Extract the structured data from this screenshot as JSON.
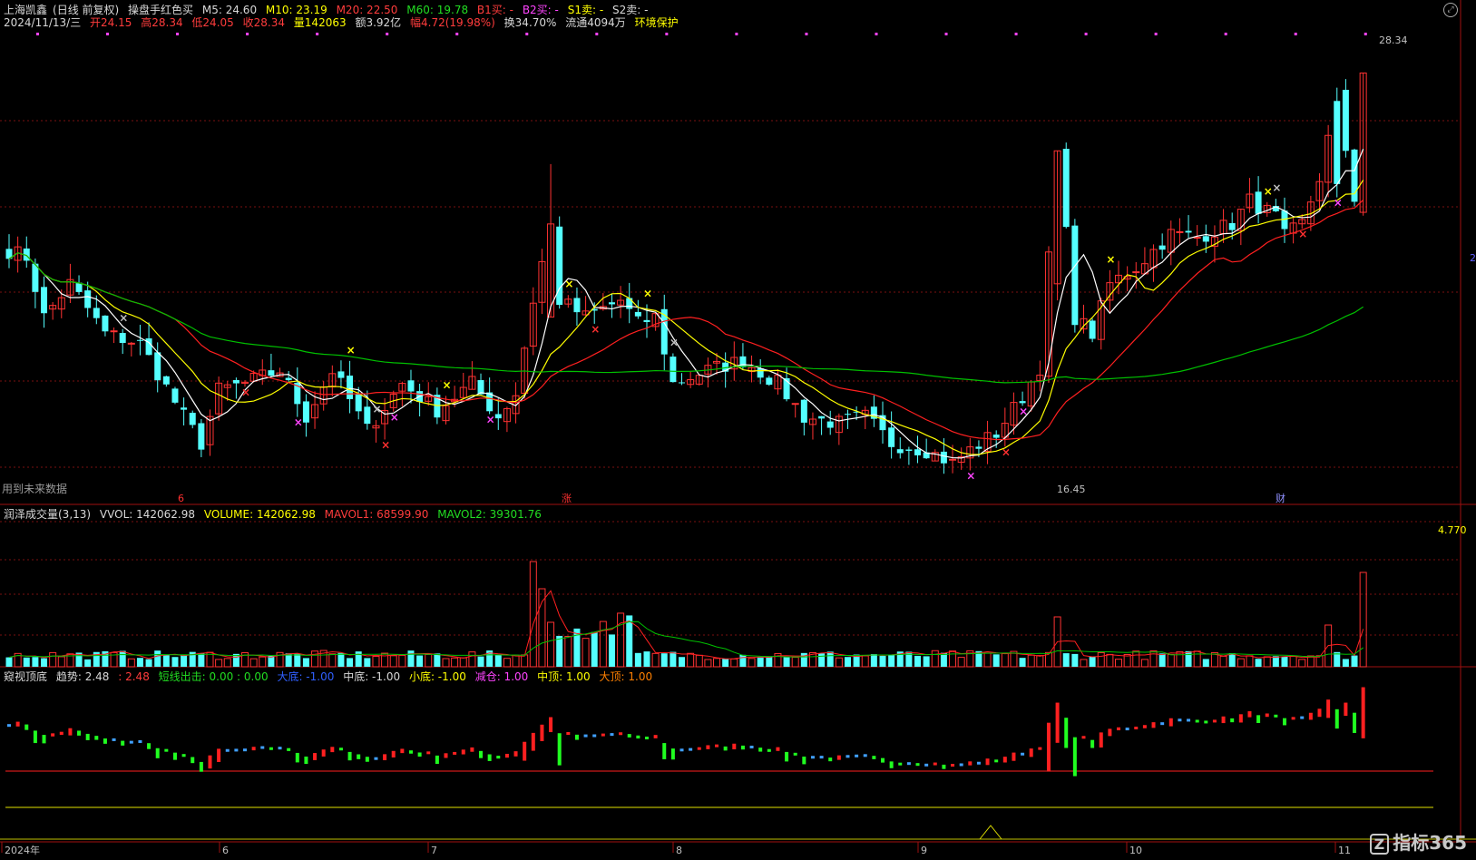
{
  "header": {
    "stock_name": "上海凯鑫",
    "mode": "(日线 前复权)",
    "indicator": "操盘手红色买",
    "m5": "M5: 24.60",
    "m10": "M10: 23.19",
    "m20": "M20: 22.50",
    "m60": "M60: 19.78",
    "b1": "B1买: -",
    "b2": "B2买: -",
    "s1": "S1卖: -",
    "s2": "S2卖: -",
    "date": "2024/11/13/三",
    "open": "开24.15",
    "high": "高28.34",
    "low": "低24.05",
    "close": "收28.34",
    "volume": "量142063",
    "amount": "额3.92亿",
    "change": "幅4.72(19.98%)",
    "turnover": "换34.70%",
    "float": "流通4094万",
    "tag": "环境保护"
  },
  "price_panel": {
    "high_label": "28.34",
    "low_label": "16.45",
    "future_note": "用到未来数据",
    "event_6": "6",
    "event_zhang": "涨",
    "event_cai": "财",
    "right_mark": "2"
  },
  "volume_panel": {
    "title": "润泽成交量(3,13)",
    "vvol": "VVOL: 142062.98",
    "volume": "VOLUME: 142062.98",
    "mavol1": "MAVOL1: 68599.90",
    "mavol2": "MAVOL2: 39301.76",
    "max_label": "4.770"
  },
  "trend_panel": {
    "title": "窥视顶底",
    "trend": "趋势: 2.48",
    "trend2": ": 2.48",
    "short": "短线出击: 0.00 : 0.00",
    "big_bottom": "大底: -1.00",
    "mid_bottom": "中底: -1.00",
    "small_bottom": "小底: -1.00",
    "reduce": "减仓: 1.00",
    "mid_top": "中顶: 1.00",
    "big_top": "大顶: 1.00"
  },
  "x_axis": {
    "labels": [
      "2024年",
      "6",
      "7",
      "8",
      "9",
      "10",
      "11"
    ]
  },
  "logo": {
    "icon": "Z",
    "text": "指标365"
  },
  "colors": {
    "up": "#ff3232",
    "down": "#54ffff",
    "m5": "#ffffff",
    "m10": "#ffff00",
    "m20": "#ff2020",
    "m60": "#00c000"
  },
  "chart_data": {
    "type": "candlestick",
    "n": 125,
    "key_prices": {
      "high": 28.34,
      "low": 16.45
    },
    "key_points": [
      [
        0,
        23.0
      ],
      [
        2,
        22.8
      ],
      [
        4,
        21.0
      ],
      [
        7,
        22.0
      ],
      [
        11,
        20.5
      ],
      [
        15,
        20.2
      ],
      [
        20,
        18.0
      ],
      [
        22,
        17.2
      ],
      [
        24,
        18.8
      ],
      [
        27,
        19.0
      ],
      [
        31,
        19.4
      ],
      [
        34,
        18.0
      ],
      [
        37,
        19.4
      ],
      [
        41,
        17.6
      ],
      [
        45,
        19.0
      ],
      [
        49,
        18.2
      ],
      [
        53,
        19.0
      ],
      [
        56,
        18.0
      ],
      [
        58,
        18.7
      ],
      [
        60,
        21.5
      ],
      [
        62,
        23.8
      ],
      [
        63,
        21.5
      ],
      [
        66,
        21.0
      ],
      [
        70,
        21.5
      ],
      [
        72,
        20.8
      ],
      [
        74,
        21.0
      ],
      [
        76,
        19.0
      ],
      [
        80,
        19.4
      ],
      [
        84,
        19.7
      ],
      [
        88,
        19.0
      ],
      [
        91,
        18.0
      ],
      [
        95,
        17.8
      ],
      [
        98,
        18.0
      ],
      [
        101,
        17.2
      ],
      [
        105,
        17.0
      ],
      [
        108,
        16.6
      ],
      [
        110,
        17.0
      ],
      [
        113,
        17.5
      ],
      [
        116,
        18.6
      ],
      [
        118,
        19.5
      ],
      [
        120,
        26.0
      ],
      [
        122,
        21.0
      ],
      [
        124,
        20.5
      ],
      [
        126,
        22.0
      ],
      [
        129,
        22.5
      ],
      [
        133,
        23.5
      ],
      [
        136,
        23.4
      ],
      [
        140,
        23.8
      ],
      [
        142,
        24.5
      ],
      [
        145,
        24.0
      ],
      [
        146,
        23.4
      ],
      [
        148,
        23.8
      ],
      [
        150,
        25.2
      ],
      [
        152,
        27.5
      ],
      [
        154,
        24.6
      ],
      [
        155,
        28.34
      ]
    ],
    "volume_spikes": [
      [
        60,
        116
      ],
      [
        61,
        86
      ],
      [
        120,
        55
      ],
      [
        151,
        46
      ],
      [
        155,
        104
      ]
    ]
  }
}
